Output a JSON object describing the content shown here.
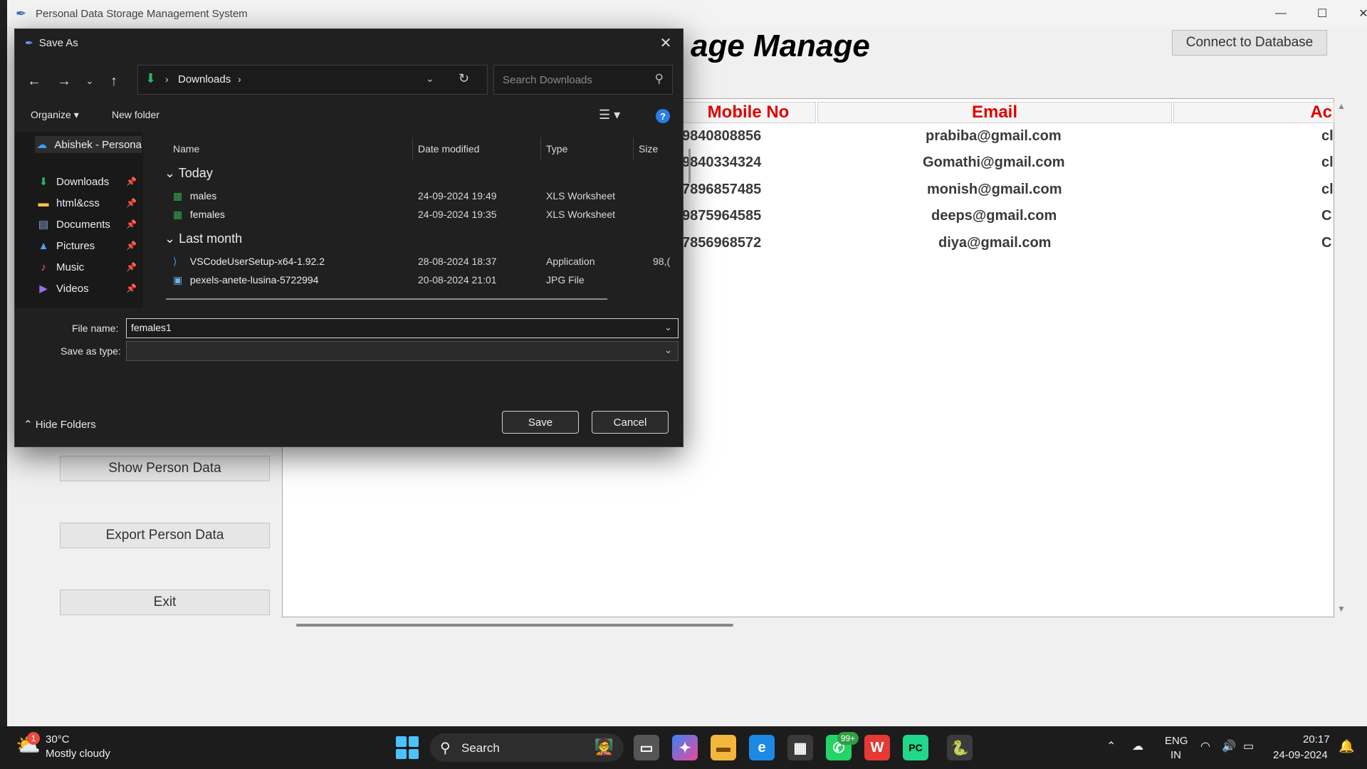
{
  "app": {
    "title": "Personal Data Storage Management System",
    "heading": "age Manage",
    "connect_button": "Connect to Database",
    "table": {
      "columns": [
        "Mobile No",
        "Email",
        "Ac"
      ],
      "rows": [
        {
          "mobile": "9840808856",
          "email": "prabiba@gmail.com",
          "ac": "cl"
        },
        {
          "mobile": "9840334324",
          "email": "Gomathi@gmail.com",
          "ac": "cl"
        },
        {
          "mobile": "7896857485",
          "email": "monish@gmail.com",
          "ac": "cl"
        },
        {
          "mobile": "9875964585",
          "email": "deeps@gmail.com",
          "ac": "C"
        },
        {
          "mobile": "7856968572",
          "email": "diya@gmail.com",
          "ac": "C"
        }
      ]
    },
    "buttons": {
      "show": "Show Person Data",
      "export": "Export Person Data",
      "exit": "Exit"
    }
  },
  "dialog": {
    "title": "Save As",
    "address": {
      "crumb": "Downloads",
      "sep": "›"
    },
    "search_placeholder": "Search Downloads",
    "toolbar": {
      "organize": "Organize ▾",
      "new_folder": "New folder",
      "help": "?"
    },
    "nav": [
      {
        "label": "Abishek - Persona",
        "icon": "onedrive-icon",
        "glyph": "☁",
        "pinned": false
      },
      {
        "label": "Downloads",
        "icon": "downloads-icon",
        "glyph": "⬇",
        "pinned": true
      },
      {
        "label": "html&css",
        "icon": "folder-icon",
        "glyph": "▬",
        "pinned": true
      },
      {
        "label": "Documents",
        "icon": "documents-icon",
        "glyph": "▤",
        "pinned": true
      },
      {
        "label": "Pictures",
        "icon": "pictures-icon",
        "glyph": "▲",
        "pinned": true
      },
      {
        "label": "Music",
        "icon": "music-icon",
        "glyph": "♪",
        "pinned": true
      },
      {
        "label": "Videos",
        "icon": "videos-icon",
        "glyph": "▶",
        "pinned": true
      }
    ],
    "columns": {
      "name": "Name",
      "date": "Date modified",
      "type": "Type",
      "size": "Size"
    },
    "groups": [
      {
        "label": "Today",
        "files": [
          {
            "name": "males",
            "date": "24-09-2024 19:49",
            "type": "XLS Worksheet",
            "size": "",
            "icon": "xls-icon"
          },
          {
            "name": "females",
            "date": "24-09-2024 19:35",
            "type": "XLS Worksheet",
            "size": "",
            "icon": "xls-icon"
          }
        ]
      },
      {
        "label": "Last month",
        "files": [
          {
            "name": "VSCodeUserSetup-x64-1.92.2",
            "date": "28-08-2024 18:37",
            "type": "Application",
            "size": "98,(",
            "icon": "vscode-icon"
          },
          {
            "name": "pexels-anete-lusina-5722994",
            "date": "20-08-2024 21:01",
            "type": "JPG File",
            "size": "",
            "icon": "jpg-icon"
          }
        ]
      }
    ],
    "file_name_label": "File name:",
    "file_name_value": "females1",
    "save_type_label": "Save as type:",
    "save_type_value": "",
    "hide_folders": "Hide Folders",
    "save_button": "Save",
    "cancel_button": "Cancel"
  },
  "taskbar": {
    "weather": {
      "temp": "30°C",
      "desc": "Mostly cloudy",
      "badge": "1"
    },
    "search_label": "Search",
    "whatsapp_badge": "99+",
    "lang": "ENG",
    "region": "IN",
    "time": "20:17",
    "date": "24-09-2024"
  }
}
